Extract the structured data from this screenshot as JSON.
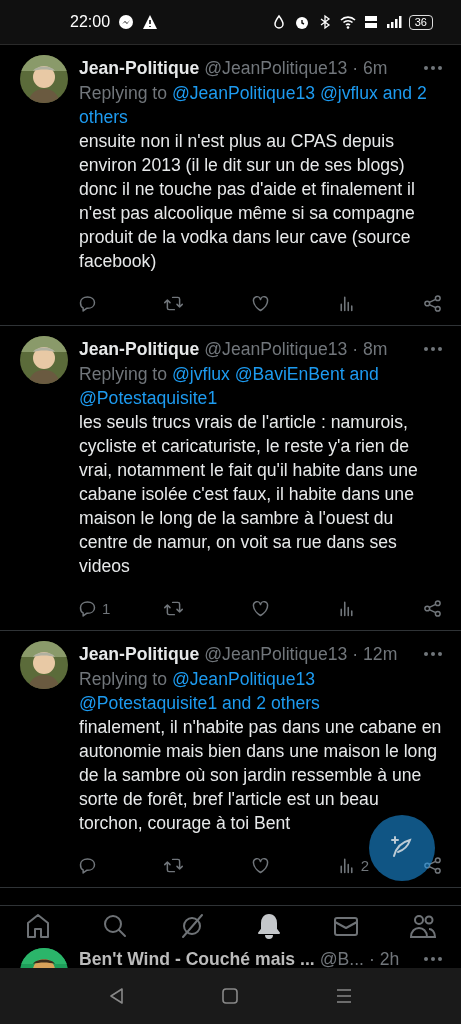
{
  "status_bar": {
    "time": "22:00",
    "battery": "36"
  },
  "tweets": [
    {
      "name": "Jean-Politique",
      "handle": "@JeanPolitique13",
      "time": "· 6m",
      "replying_prefix": "Replying to",
      "replying_to": "@JeanPolitique13 @jvflux and 2 others",
      "text": "ensuite non il n'est plus au CPAS depuis environ 2013 (il le dit sur un de ses blogs) donc il ne touche pas d'aide et finalement il n'est pas alcoolique même si sa compagne produit de la vodka dans leur cave (source facebook)"
    },
    {
      "name": "Jean-Politique",
      "handle": "@JeanPolitique13",
      "time": "· 8m",
      "replying_prefix": "Replying to",
      "replying_to": "@jvflux @BaviEnBent and @Potestaquisite1",
      "text": "les seuls trucs vrais de l'article : namurois, cycliste et caricaturiste, le reste y'a rien de vrai, notamment le fait qu'il habite dans une cabane isolée c'est faux, il habite dans une maison le long de la sambre à l'ouest du centre de namur, on voit sa rue dans ses videos",
      "reply_count": "1"
    },
    {
      "name": "Jean-Politique",
      "handle": "@JeanPolitique13",
      "time": "· 12m",
      "replying_prefix": "Replying to",
      "replying_to": "@JeanPolitique13 @Potestaquisite1 and 2 others",
      "text": "finalement, il n'habite pas dans une cabane en autonomie mais bien dans une maison le long de la sambre où son jardin ressemble à une sorte de forêt, bref l'article est un beau torchon, courage à toi Bent",
      "views_count": "2"
    }
  ],
  "bottom_nav": [
    {
      "kind": "home",
      "selected": false
    },
    {
      "kind": "search",
      "selected": false
    },
    {
      "kind": "grok",
      "selected": false
    },
    {
      "kind": "bell",
      "selected": true
    },
    {
      "kind": "mail",
      "selected": false
    },
    {
      "kind": "people",
      "selected": false
    }
  ],
  "next_tweet": {
    "name": "Ben't Wind - Couché mais ...",
    "handle": "@B...",
    "time": "· 2h"
  }
}
